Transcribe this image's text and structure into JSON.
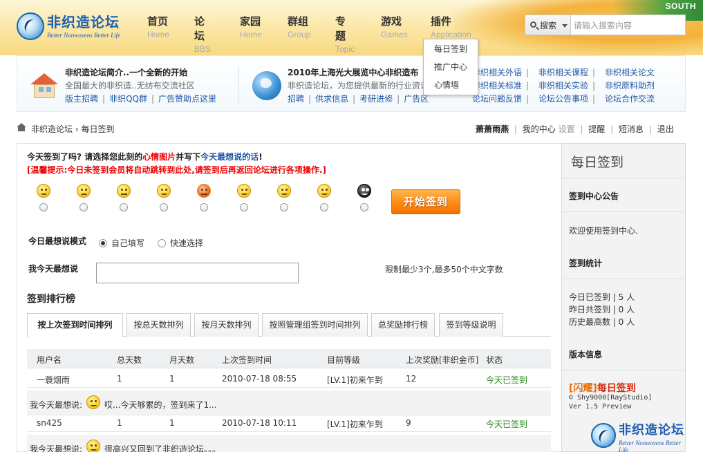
{
  "header": {
    "south_text": "SOUTH",
    "logo_cn": "非织造论坛",
    "logo_en": "Better Nonwovens Better Life",
    "nav": [
      {
        "cn": "首页",
        "en": "Home"
      },
      {
        "cn": "论坛",
        "en": "BBS"
      },
      {
        "cn": "家园",
        "en": "Home"
      },
      {
        "cn": "群组",
        "en": "Group"
      },
      {
        "cn": "专题",
        "en": "Topic"
      },
      {
        "cn": "游戏",
        "en": "Games"
      },
      {
        "cn": "插件",
        "en": "Application"
      }
    ],
    "search_label": "搜索",
    "search_placeholder": "请输入搜索内容"
  },
  "dropdown": [
    "每日签到",
    "推广中心",
    "心情墙"
  ],
  "info": {
    "title1": "非织造论坛简介..一个全新的开始",
    "sub1": "全国最大的非织造..无纺布交流社区",
    "links1": [
      "版主招聘",
      "非织QQ群",
      "广告赞助点这里"
    ],
    "title2": "2010年上海光大展览中心非织造布",
    "sub2": "非织造论坛，为您提供最新的行业资讯",
    "links2": [
      "招聘",
      "供求信息",
      "考研进修",
      "广告区"
    ],
    "right_col1": [
      "非织相关外语",
      "非织相关标准",
      "论坛问题反馈"
    ],
    "right_col2": [
      "非织相关课程",
      "非织相关实验",
      "论坛公告事项"
    ],
    "right_col3": [
      "非织相关论文",
      "非织原料助剂",
      "论坛合作交流"
    ]
  },
  "breadcrumb": {
    "site": "非织造论坛",
    "sep": "›",
    "page": "每日签到"
  },
  "userbar": {
    "name": "萧萧雨燕",
    "center": "我的中心",
    "settings": "设置",
    "remind": "提醒",
    "message": "短消息",
    "logout": "退出"
  },
  "main": {
    "q1_a": "今天签到了吗? 请选择您此刻的",
    "q1_b": "心情图片",
    "q1_c": "并写下",
    "q1_d": "今天最想说的话",
    "q1_e": "!",
    "q2": "[温馨提示:今日未签到会员将自动跳转到此处,请签到后再返回论坛进行各项操作.]",
    "sign_button": "开始签到",
    "mode_label": "今日最想说模式",
    "mode_opt1": "自己填写",
    "mode_opt2": "快速选择",
    "say_label": "我今天最想说",
    "say_hint": "限制最少3个,最多50个中文字数",
    "rank_title": "签到排行榜",
    "tabs": [
      "按上次签到时间排列",
      "按总天数排列",
      "按月天数排列",
      "按照管理组签到时间排列",
      "总奖励排行榜",
      "签到等级说明"
    ],
    "columns": [
      "用户名",
      "总天数",
      "月天数",
      "上次签到时间",
      "目前等级",
      "上次奖励[非织金币]",
      "状态"
    ],
    "rows": [
      {
        "user": "一蓑烟雨",
        "total": "1",
        "month": "1",
        "time": "2010-07-18 08:55",
        "level": "[LV.1]初来乍到",
        "reward": "12",
        "status": "今天已签到",
        "say_prefix": "我今天最想说:",
        "say": "哎...今天够累的，签到来了1..."
      },
      {
        "user": "sn425",
        "total": "1",
        "month": "1",
        "time": "2010-07-18 10:11",
        "level": "[LV.1]初来乍到",
        "reward": "9",
        "status": "今天已签到",
        "say_prefix": "我今天最想说:",
        "say": "很高兴又回到了非织造论坛。。。"
      }
    ]
  },
  "side": {
    "title": "每日签到",
    "notice_h": "签到中心公告",
    "notice": "欢迎使用签到中心.",
    "stat_h": "签到统计",
    "stats": [
      "今日已签到 | 5 人",
      "昨日共签到 | 0 人",
      "历史最高数 | 0 人"
    ],
    "ver_h": "版本信息",
    "brand_a": "[闪耀]",
    "brand_b": "每日签到",
    "copy1": "© Shy9000[RayStudio]",
    "copy2": "Ver 1.5 Preview"
  },
  "colors": {
    "accent": "#1f56a3",
    "red": "#e00000",
    "green": "#2a8a1e",
    "button": "#ff8a14"
  }
}
